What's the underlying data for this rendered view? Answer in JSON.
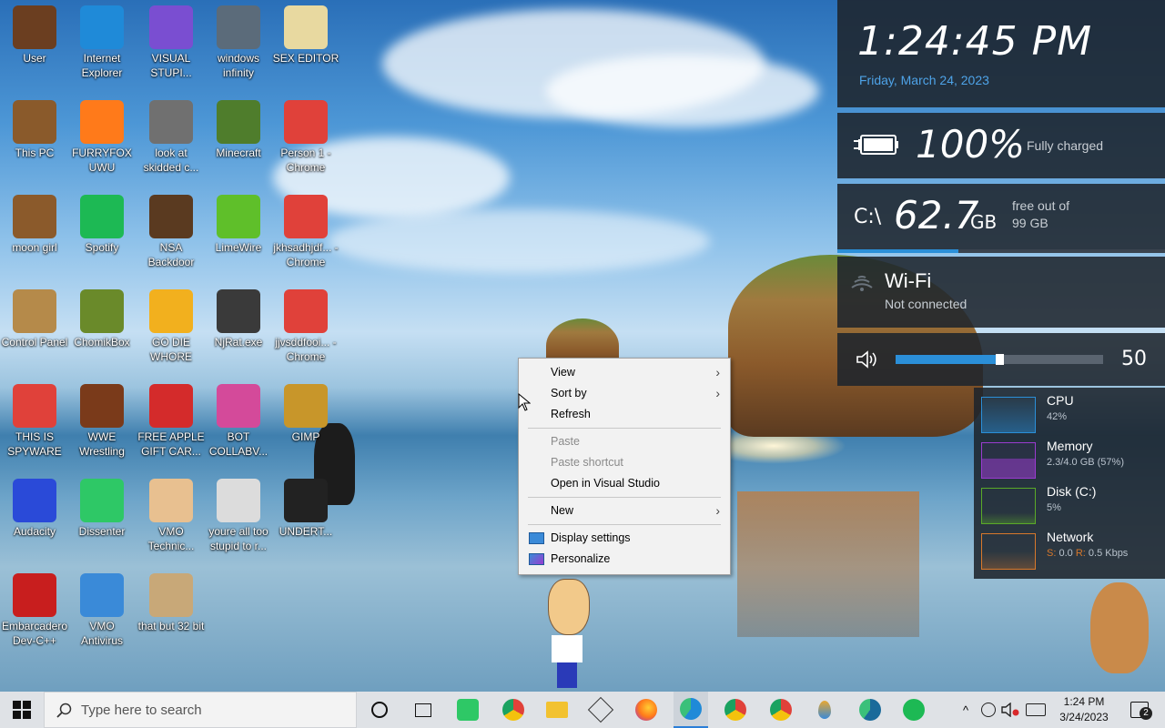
{
  "desktop_icons": [
    {
      "label": "User",
      "icon": "user-folder-icon",
      "color": "#6b3e20"
    },
    {
      "label": "Internet Explorer",
      "icon": "edge-icon",
      "color": "#1f8ad8"
    },
    {
      "label": "VISUAL STUPI...",
      "icon": "visual-studio-icon",
      "color": "#7a4ed1"
    },
    {
      "label": "windows infinity",
      "icon": "box-icon",
      "color": "#5b6b7a"
    },
    {
      "label": "SEX EDITOR",
      "icon": "hxd-icon",
      "color": "#e8d9a0"
    },
    {
      "label": "This PC",
      "icon": "old-computer-icon",
      "color": "#8a5a2b"
    },
    {
      "label": "FURRYFOX UWU",
      "icon": "firefox-icon",
      "color": "#ff7a1a"
    },
    {
      "label": "look at skidded c...",
      "icon": "copy-windows-icon",
      "color": "#707070"
    },
    {
      "label": "Minecraft",
      "icon": "minecraft-block-icon",
      "color": "#4f7d2c"
    },
    {
      "label": "Person 1 - Chrome",
      "icon": "chrome-profile-icon",
      "color": "#e0413a"
    },
    {
      "label": "moon girl",
      "icon": "wood-block-icon",
      "color": "#8b5a2b"
    },
    {
      "label": "Spotify",
      "icon": "spotify-icon",
      "color": "#1db954"
    },
    {
      "label": "NSA Backdoor",
      "icon": "safe-icon",
      "color": "#5a3a20"
    },
    {
      "label": "LimeWire",
      "icon": "limewire-icon",
      "color": "#5fbf2a"
    },
    {
      "label": "jkhsadhjdf... - Chrome",
      "icon": "chrome-profile-icon",
      "color": "#e0413a"
    },
    {
      "label": "Control Panel",
      "icon": "lamp-icon",
      "color": "#b58a4a"
    },
    {
      "label": "ChomikBox",
      "icon": "chomikbox-icon",
      "color": "#6a8a2a"
    },
    {
      "label": "GO DIE WHORE",
      "icon": "de-icon",
      "color": "#f2b01e"
    },
    {
      "label": "NjRat.exe",
      "icon": "skull-icon",
      "color": "#3a3a3a"
    },
    {
      "label": "jjvsddfooi... - Chrome",
      "icon": "chrome-profile-icon",
      "color": "#e0413a"
    },
    {
      "label": "THIS IS SPYWARE",
      "icon": "chrome-icon",
      "color": "#e0413a"
    },
    {
      "label": "WWE Wrestling",
      "icon": "arcade-icon",
      "color": "#7a3a1a"
    },
    {
      "label": "FREE APPLE GIFT CAR...",
      "icon": "apple-icon",
      "color": "#d42b2b"
    },
    {
      "label": "BOT COLLABV...",
      "icon": "pink-window-icon",
      "color": "#d44a9a"
    },
    {
      "label": "GIMP",
      "icon": "file-icon",
      "color": "#c8962a"
    },
    {
      "label": "Audacity",
      "icon": "audacity-icon",
      "color": "#2a4ad8"
    },
    {
      "label": "Dissenter",
      "icon": "dissenter-icon",
      "color": "#2ec866"
    },
    {
      "label": "VMO Technic...",
      "icon": "doctor-icon",
      "color": "#e8c090"
    },
    {
      "label": "youre all too stupid to r...",
      "icon": "portrait-icon",
      "color": "#dcdcdc"
    },
    {
      "label": "UNDERT...",
      "icon": "unity-icon",
      "color": "#222222"
    },
    {
      "label": "Embarcadero Dev-C++",
      "icon": "devcpp-icon",
      "color": "#c81e1e"
    },
    {
      "label": "VMO Antivirus",
      "icon": "shield-icon",
      "color": "#3a8ad8"
    },
    {
      "label": "that but 32 bit",
      "icon": "portrait-icon",
      "color": "#c8a878"
    }
  ],
  "clock": {
    "time": "1:24:45 PM",
    "date": "Friday, March 24, 2023"
  },
  "battery": {
    "percent": "100%",
    "status": "Fully charged",
    "level": 1.0
  },
  "disk": {
    "drive": "C:\\",
    "free": "62.7",
    "unit": "GB",
    "line1": "free out of",
    "line2": "99 GB",
    "used_fraction": 0.37
  },
  "wifi": {
    "name": "Wi-Fi",
    "status": "Not connected"
  },
  "volume": {
    "value": "50",
    "level": 0.5
  },
  "performance": [
    {
      "name": "CPU",
      "value": "42%",
      "color": "#2b8fd8"
    },
    {
      "name": "Memory",
      "value": "2.3/4.0 GB (57%)",
      "color": "#9a3bd0"
    },
    {
      "name": "Disk (C:)",
      "value": "5%",
      "color": "#5aaa28"
    },
    {
      "name": "Network",
      "value_s_label": "S:",
      "value_s": "0.0",
      "value_r_label": "R:",
      "value_r": "0.5 Kbps",
      "color": "#d8782b"
    }
  ],
  "context_menu": {
    "view": "View",
    "sort_by": "Sort by",
    "refresh": "Refresh",
    "paste": "Paste",
    "paste_shortcut": "Paste shortcut",
    "open_vs": "Open in Visual Studio",
    "new": "New",
    "display_settings": "Display settings",
    "personalize": "Personalize"
  },
  "taskbar": {
    "search_placeholder": "Type here to search",
    "time": "1:24 PM",
    "date": "3/24/2023",
    "notification_count": "2"
  }
}
